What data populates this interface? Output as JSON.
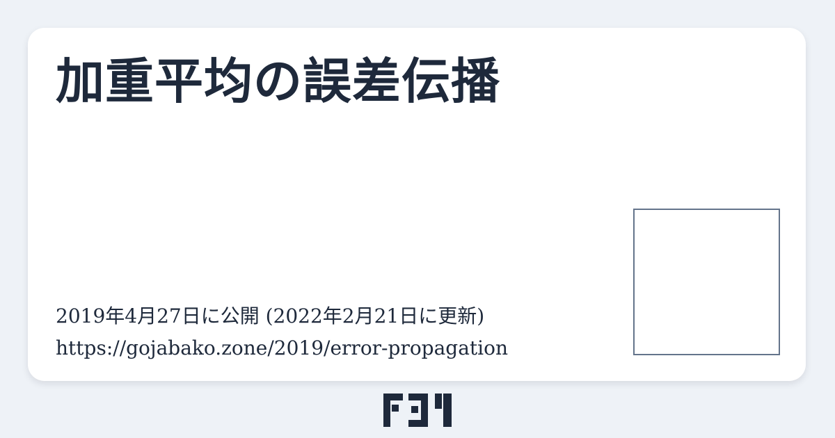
{
  "card": {
    "title": "加重平均の誤差伝播",
    "dates": "2019年4月27日に公開 (2022年2月21日に更新)",
    "url": "https://gojabako.zone/2019/error-propagation"
  },
  "colors": {
    "background": "#eef2f7",
    "card": "#ffffff",
    "text": "#1e293b",
    "thumbnail_border": "#64748b"
  },
  "icons": {
    "logo": "bracket-logo-icon"
  }
}
